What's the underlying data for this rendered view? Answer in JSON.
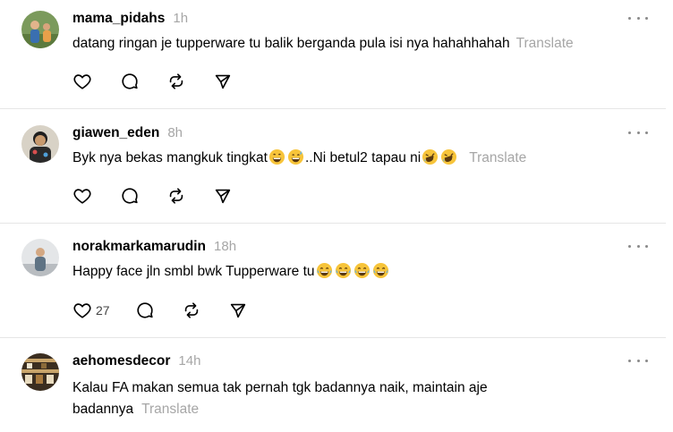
{
  "posts": [
    {
      "username": "mama_pidahs",
      "time": "1h",
      "text": "datang ringan je tupperware tu balik berganda pula isi nya hahahhahah",
      "emojis": "",
      "text_after_emojis": "",
      "translate": "Translate",
      "like_count": "",
      "avatar_colors": [
        "#6d8a4f",
        "#3a6fb0",
        "#e8a04a"
      ]
    },
    {
      "username": "giawen_eden",
      "time": "8h",
      "text": "Byk nya bekas mangkuk tingkat",
      "emojis": "😄😅",
      "text_after_emojis": "..Ni betul2 tapau ni🤣🤣",
      "translate": "Translate",
      "like_count": "",
      "avatar_colors": [
        "#2e2e2e",
        "#8a6a4a",
        "#d9c19a"
      ]
    },
    {
      "username": "norakmarkamarudin",
      "time": "18h",
      "text": "Happy face jln smbl bwk Tupperware tu",
      "emojis": "😂😂😂😂",
      "text_after_emojis": "",
      "translate": "",
      "like_count": "27",
      "avatar_colors": [
        "#c9c9c9",
        "#6a7d8e",
        "#f0f0f0"
      ]
    },
    {
      "username": "aehomesdecor",
      "time": "14h",
      "text": "Kalau FA makan semua tak pernah tgk badannya naik, maintain aje badannya",
      "emojis": "",
      "text_after_emojis": "",
      "translate": "Translate",
      "like_count": "",
      "avatar_colors": [
        "#5a4630",
        "#c8a46a",
        "#2f2418"
      ]
    }
  ],
  "icons": {
    "like": "heart-icon",
    "reply": "comment-icon",
    "repost": "repost-icon",
    "share": "send-icon",
    "more": "more-icon"
  },
  "colors": {
    "muted": "#a6a6a6",
    "divider": "#e6e6e6"
  }
}
